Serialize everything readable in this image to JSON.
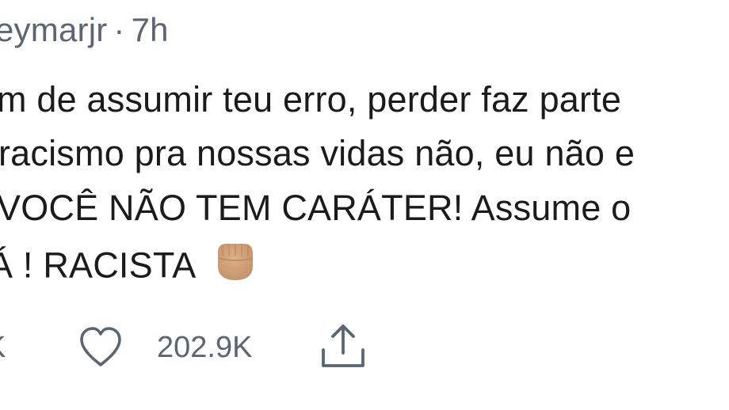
{
  "tweet": {
    "header": {
      "username": "eymarjr",
      "separator": "·",
      "time": "7h"
    },
    "text_lines": [
      "m de assumir teu erro, perder faz parte",
      "racismo pra nossas vidas não, eu não e",
      "VOCÊ NÃO TEM CARÁTER! Assume o",
      "Á ! RACISTA"
    ],
    "emoji": "fist-icon",
    "actions": {
      "retweet_count": "K",
      "like_count": "202.9K",
      "like_icon": "heart-icon",
      "share_icon": "share-icon"
    }
  }
}
